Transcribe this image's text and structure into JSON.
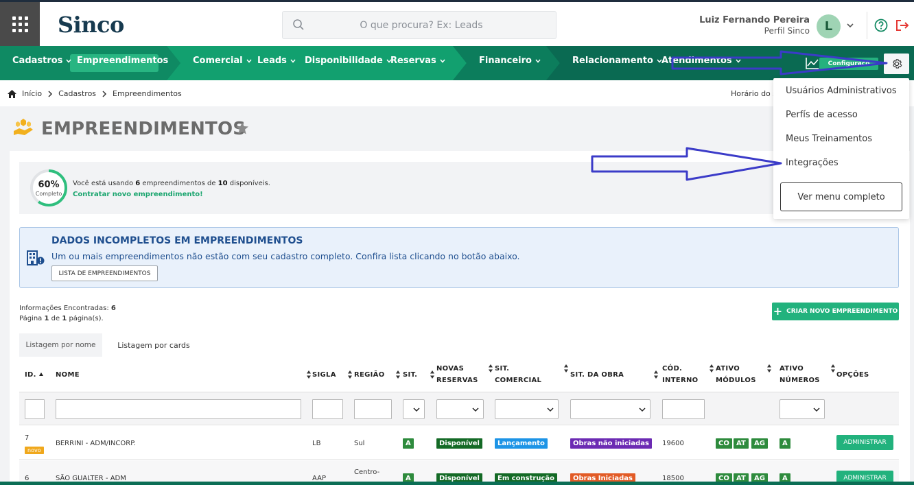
{
  "header": {
    "logo": "Sinco",
    "search_placeholder": "O que procura? Ex: Leads",
    "user_name": "Luiz Fernando Pereira",
    "user_profile": "Perfil Sinco",
    "avatar_letter": "L"
  },
  "nav": {
    "items": [
      "Cadastros",
      "Empreendimentos",
      "Comercial",
      "Leads",
      "Disponibilidade",
      "Reservas",
      "Financeiro",
      "Relacionamento",
      "Atendimentos"
    ],
    "config_label": "Configuraçõ",
    "active_index": 1
  },
  "breadcrumb": {
    "items": [
      "Início",
      "Cadastros",
      "Empreendimentos"
    ],
    "right_text": "Horário do s"
  },
  "page": {
    "title": "EMPREENDIMENTOS"
  },
  "usage": {
    "percent_label": "60%",
    "percent_value": 0.6,
    "complete_label": "Completo",
    "text_prefix": "Você está usando ",
    "used": "6",
    "text_mid": " empreendimentos de ",
    "total": "10",
    "text_suffix": " disponíveis.",
    "link": "Contratar novo empreendimento!"
  },
  "alert": {
    "title": "DADOS INCOMPLETOS EM EMPREENDIMENTOS",
    "text": "Um ou mais empreendimentos não estão com seu cadastro completo. Confira lista clicando no botão abaixo.",
    "button": "LISTA DE EMPREENDIMENTOS"
  },
  "info": {
    "found_label": "Informações Encontradas: ",
    "found_count": "6",
    "page_prefix": "Página ",
    "page_current": "1",
    "page_mid": " de ",
    "page_total": "1",
    "page_suffix": " página(s)."
  },
  "create_button": "CRIAR NOVO EMPREENDIMENTO",
  "tabs": [
    "Listagem por nome",
    "Listagem por cards"
  ],
  "table": {
    "headers": {
      "id": "ID.",
      "nome": "NOME",
      "sigla": "SIGLA",
      "regiao": "REGIÃO",
      "sit": "SIT.",
      "novas_1": "NOVAS",
      "novas_2": "RESERVAS",
      "sitcom_1": "SIT.",
      "sitcom_2": "COMERCIAL",
      "sitobra": "SIT. DA OBRA",
      "cod_1": "CÓD.",
      "cod_2": "INTERNO",
      "mod_1": "ATIVO",
      "mod_2": "MÓDULOS",
      "num_1": "ATIVO",
      "num_2": "NÚMEROS",
      "opcoes": "OPÇÕES"
    },
    "rows": [
      {
        "id": "7",
        "tag": "novo",
        "nome": "BERRINI - ADM/INCORP.",
        "sigla": "LB",
        "regiao": "Sul",
        "sit": "A",
        "novas": "Disponível",
        "sitcom": "Lançamento",
        "sitobra": "Obras não iniciadas",
        "cod": "19600",
        "mod": [
          "CO",
          "AT",
          "AG"
        ],
        "num": "A",
        "action": "ADMINISTRAR"
      },
      {
        "id": "6",
        "nome": "SÃO GUALTER - ADM",
        "sigla": "AAP",
        "regiao": "Centro-",
        "sit": "A",
        "novas": "Disponível",
        "sitcom": "Em construção",
        "sitobra": "Obras Iniciadas",
        "cod": "18500",
        "mod": [
          "CO",
          "AT",
          "AG"
        ],
        "num": "A",
        "action": "ADMINISTRAR"
      }
    ]
  },
  "dropdown": {
    "items": [
      "Usuários Administrativos",
      "Perfís de acesso",
      "Meus Treinamentos",
      "Integrações"
    ],
    "button": "Ver menu completo"
  },
  "colors": {
    "nav_green": "#0b6e55",
    "accent_green": "#22b27d",
    "annotation_arrow": "#3b3bc8"
  }
}
